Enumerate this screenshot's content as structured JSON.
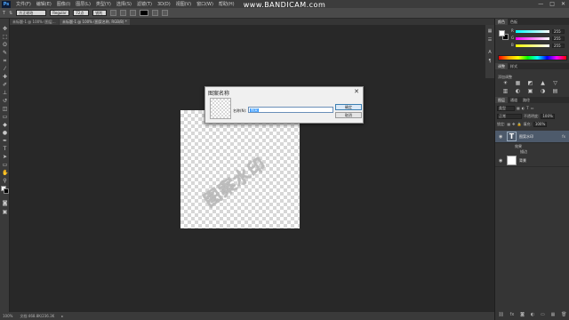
{
  "menubar": {
    "logo": "Ps",
    "items": [
      "文件(F)",
      "编辑(E)",
      "图像(I)",
      "图层(L)",
      "类型(Y)",
      "选择(S)",
      "滤镜(T)",
      "3D(D)",
      "视图(V)",
      "窗口(W)",
      "帮助(H)"
    ],
    "controls": [
      "—",
      "□",
      "✕"
    ]
  },
  "watermark": "www.BANDICAM.com",
  "options": {
    "tool_glyph": "T",
    "orientation_glyph": "⇅",
    "font_family": "方正琥珀",
    "font_style": "Regular",
    "size": "72点",
    "antialias": "锐利",
    "color": "#000000"
  },
  "tabs": {
    "doc1": "未标题-1 @ 100% (图层...",
    "doc2": "未标题-1 @ 100% (图案名称, RGB/8) *"
  },
  "canvas": {
    "text": "图案水印"
  },
  "dialog": {
    "title": "图案名称",
    "close_glyph": "✕",
    "name_label": "名称(N):",
    "name_value": "图案",
    "ok_label": "确定",
    "cancel_label": "取消"
  },
  "status": {
    "zoom": "100%",
    "doc": "文档:468.8K/236.3K",
    "arrow": "▸"
  },
  "panels": {
    "color_tabs": [
      "颜色",
      "色板"
    ],
    "color": {
      "channels": [
        {
          "label": "R",
          "value": "255"
        },
        {
          "label": "G",
          "value": "255"
        },
        {
          "label": "B",
          "value": "255"
        }
      ]
    },
    "adjust_tabs": [
      "调整",
      "样式"
    ],
    "adjust_subtitle": "添加调整",
    "adjust_icons": [
      "☀",
      "▦",
      "◩",
      "▲",
      "▽",
      "▥",
      "◐",
      "▣",
      "◑",
      "▤",
      "◧",
      "◨",
      "▨",
      "◫",
      "▧"
    ],
    "layers_tabs": [
      "图层",
      "通道",
      "路径"
    ],
    "layers": {
      "kind": "类型",
      "blend": "正常",
      "opacity_label": "不透明度:",
      "opacity": "100%",
      "lock_label": "锁定:",
      "fill_label": "填充:",
      "fill": "100%",
      "rows": [
        {
          "name": "图案水印",
          "type": "text",
          "fx": "fx"
        },
        {
          "name": "背景",
          "type": "bg",
          "fx": ""
        }
      ],
      "effects_label": "效果",
      "effect_item": "描边",
      "footer": [
        "⛓",
        "fx",
        "◙",
        "◐",
        "▭",
        "▦",
        "🗑"
      ]
    }
  }
}
